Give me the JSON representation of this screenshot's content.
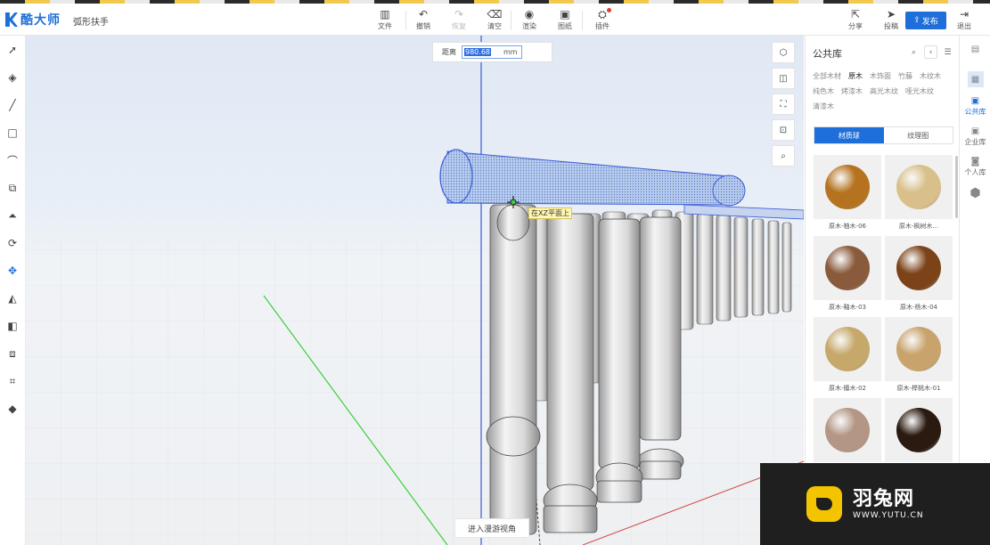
{
  "app": {
    "brand": "酷大师",
    "document_title": "弧形扶手"
  },
  "toolbar": {
    "file": "文件",
    "undo": "撤销",
    "redo": "恢复",
    "clear": "清空",
    "render": "渲染",
    "drawing": "图纸",
    "plugins": "插件",
    "share": "分享",
    "submit": "投稿",
    "publish": "发布",
    "exit": "退出"
  },
  "viewport": {
    "distance_label": "距离",
    "distance_value": "980.68",
    "distance_unit": "mm",
    "plane_tip": "在XZ平面上",
    "roam_button": "进入漫游视角"
  },
  "library": {
    "title": "公共库",
    "categories": [
      "全部木材",
      "原木",
      "木饰面",
      "竹藤",
      "木纹木",
      "纯色木",
      "烤漆木",
      "高光木纹",
      "哑光木纹",
      "清漆木"
    ],
    "active_category": "原木",
    "tabs": [
      "材质球",
      "纹理图"
    ],
    "active_tab": "材质球",
    "materials": [
      {
        "label": "原木-柚木-06",
        "color": "#b5731f"
      },
      {
        "label": "原木-枫树木...",
        "color": "#d9c08a"
      },
      {
        "label": "原木-釉木-03",
        "color": "#8a5a3c"
      },
      {
        "label": "原木-杨木-04",
        "color": "#7c4318"
      },
      {
        "label": "原木-檀木-02",
        "color": "#c6a86a"
      },
      {
        "label": "原木-榉桃木-01",
        "color": "#c9a36c"
      },
      {
        "label": "",
        "color": "#b39684"
      },
      {
        "label": "",
        "color": "#2a1a10"
      }
    ]
  },
  "right_rail": {
    "public": "公共库",
    "enterprise": "企业库",
    "personal": "个人库"
  },
  "watermark": {
    "name": "羽兔网",
    "url": "WWW.YUTU.CN"
  }
}
